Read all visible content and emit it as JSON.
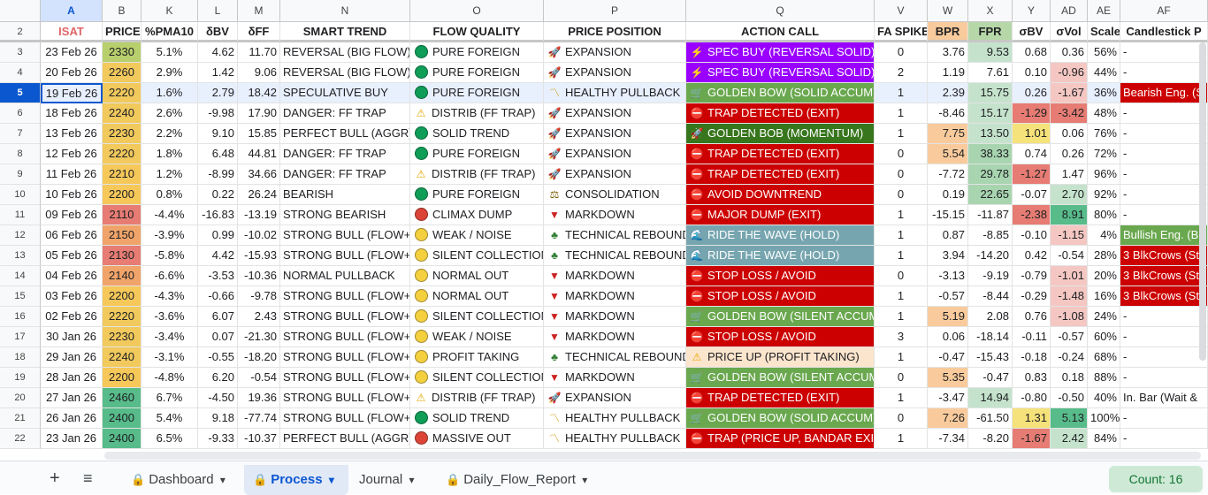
{
  "columns": [
    {
      "letter": "A",
      "title": "ISAT"
    },
    {
      "letter": "B",
      "title": "PRICE"
    },
    {
      "letter": "K",
      "title": "%PMA10"
    },
    {
      "letter": "L",
      "title": "δBV"
    },
    {
      "letter": "M",
      "title": "δFF"
    },
    {
      "letter": "N",
      "title": "SMART TREND"
    },
    {
      "letter": "O",
      "title": "FLOW QUALITY"
    },
    {
      "letter": "P",
      "title": "PRICE POSITION"
    },
    {
      "letter": "Q",
      "title": "ACTION CALL"
    },
    {
      "letter": "V",
      "title": "FA SPIKE"
    },
    {
      "letter": "W",
      "title": "BPR"
    },
    {
      "letter": "X",
      "title": "FPR"
    },
    {
      "letter": "Y",
      "title": "σBV"
    },
    {
      "letter": "AD",
      "title": "σVol"
    },
    {
      "letter": "AE",
      "title": "Scale"
    },
    {
      "letter": "AF",
      "title": "Candlestick P"
    }
  ],
  "header_row_number": "2",
  "rows": [
    {
      "n": "3",
      "date": "23 Feb 26",
      "price": "2330",
      "pma": "5.1%",
      "dbv": "4.62",
      "dff": "11.70",
      "trend": "REVERSAL (BIG FLOW)",
      "flow": "PURE FOREIGN",
      "pos": "EXPANSION",
      "action": "SPEC BUY (REVERSAL SOLID)",
      "fa": "0",
      "bpr": "3.76",
      "fpr": "9.53",
      "sbv": "0.68",
      "svol": "0.36",
      "scale": "56%",
      "candle": "-"
    },
    {
      "n": "4",
      "date": "20 Feb 26",
      "price": "2260",
      "pma": "2.9%",
      "dbv": "1.42",
      "dff": "9.06",
      "trend": "REVERSAL (BIG FLOW)",
      "flow": "PURE FOREIGN",
      "pos": "EXPANSION",
      "action": "SPEC BUY (REVERSAL SOLID)",
      "fa": "2",
      "bpr": "1.19",
      "fpr": "7.61",
      "sbv": "0.10",
      "svol": "-0.96",
      "scale": "44%",
      "candle": "-"
    },
    {
      "n": "5",
      "date": "19 Feb 26",
      "price": "2220",
      "pma": "1.6%",
      "dbv": "2.79",
      "dff": "18.42",
      "trend": "SPECULATIVE BUY",
      "flow": "PURE FOREIGN",
      "pos": "HEALTHY PULLBACK",
      "action": "GOLDEN BOW (SOLID ACCUM)",
      "fa": "1",
      "bpr": "2.39",
      "fpr": "15.75",
      "sbv": "0.26",
      "svol": "-1.67",
      "scale": "36%",
      "candle": "Bearish Eng. (S"
    },
    {
      "n": "6",
      "date": "18 Feb 26",
      "price": "2240",
      "pma": "2.6%",
      "dbv": "-9.98",
      "dff": "17.90",
      "trend": "DANGER: FF TRAP",
      "flow": "DISTRIB (FF TRAP)",
      "pos": "EXPANSION",
      "action": "TRAP DETECTED (EXIT)",
      "fa": "1",
      "bpr": "-8.46",
      "fpr": "15.17",
      "sbv": "-1.29",
      "svol": "-3.42",
      "scale": "48%",
      "candle": "-"
    },
    {
      "n": "7",
      "date": "13 Feb 26",
      "price": "2230",
      "pma": "2.2%",
      "dbv": "9.10",
      "dff": "15.85",
      "trend": "PERFECT BULL (AGGR)",
      "flow": "SOLID TREND",
      "pos": "EXPANSION",
      "action": "GOLDEN BOB (MOMENTUM)",
      "fa": "1",
      "bpr": "7.75",
      "fpr": "13.50",
      "sbv": "1.01",
      "svol": "0.06",
      "scale": "76%",
      "candle": "-"
    },
    {
      "n": "8",
      "date": "12 Feb 26",
      "price": "2220",
      "pma": "1.8%",
      "dbv": "6.48",
      "dff": "44.81",
      "trend": "DANGER: FF TRAP",
      "flow": "PURE FOREIGN",
      "pos": "EXPANSION",
      "action": "TRAP DETECTED (EXIT)",
      "fa": "0",
      "bpr": "5.54",
      "fpr": "38.33",
      "sbv": "0.74",
      "svol": "0.26",
      "scale": "72%",
      "candle": "-"
    },
    {
      "n": "9",
      "date": "11 Feb 26",
      "price": "2210",
      "pma": "1.2%",
      "dbv": "-8.99",
      "dff": "34.66",
      "trend": "DANGER: FF TRAP",
      "flow": "DISTRIB (FF TRAP)",
      "pos": "EXPANSION",
      "action": "TRAP DETECTED (EXIT)",
      "fa": "0",
      "bpr": "-7.72",
      "fpr": "29.78",
      "sbv": "-1.27",
      "svol": "1.47",
      "scale": "96%",
      "candle": "-"
    },
    {
      "n": "10",
      "date": "10 Feb 26",
      "price": "2200",
      "pma": "0.8%",
      "dbv": "0.22",
      "dff": "26.24",
      "trend": "BEARISH",
      "flow": "PURE FOREIGN",
      "pos": "CONSOLIDATION",
      "action": "AVOID DOWNTREND",
      "fa": "0",
      "bpr": "0.19",
      "fpr": "22.65",
      "sbv": "-0.07",
      "svol": "2.70",
      "scale": "92%",
      "candle": "-"
    },
    {
      "n": "11",
      "date": "09 Feb 26",
      "price": "2110",
      "pma": "-4.4%",
      "dbv": "-16.83",
      "dff": "-13.19",
      "trend": "STRONG BEARISH",
      "flow": "CLIMAX DUMP",
      "pos": "MARKDOWN",
      "action": "MAJOR DUMP (EXIT)",
      "fa": "1",
      "bpr": "-15.15",
      "fpr": "-11.87",
      "sbv": "-2.38",
      "svol": "8.91",
      "scale": "80%",
      "candle": "-"
    },
    {
      "n": "12",
      "date": "06 Feb 26",
      "price": "2150",
      "pma": "-3.9%",
      "dbv": "0.99",
      "dff": "-10.02",
      "trend": "STRONG BULL (FLOW+)",
      "flow": "WEAK / NOISE",
      "pos": "TECHNICAL REBOUND",
      "action": "RIDE THE WAVE (HOLD)",
      "fa": "1",
      "bpr": "0.87",
      "fpr": "-8.85",
      "sbv": "-0.10",
      "svol": "-1.15",
      "scale": "4%",
      "candle": "Bullish Eng. (B"
    },
    {
      "n": "13",
      "date": "05 Feb 26",
      "price": "2130",
      "pma": "-5.8%",
      "dbv": "4.42",
      "dff": "-15.93",
      "trend": "STRONG BULL (FLOW+)",
      "flow": "SILENT COLLECTION",
      "pos": "TECHNICAL REBOUND",
      "action": "RIDE THE WAVE (HOLD)",
      "fa": "1",
      "bpr": "3.94",
      "fpr": "-14.20",
      "sbv": "0.42",
      "svol": "-0.54",
      "scale": "28%",
      "candle": "3 BlkCrows (St"
    },
    {
      "n": "14",
      "date": "04 Feb 26",
      "price": "2140",
      "pma": "-6.6%",
      "dbv": "-3.53",
      "dff": "-10.36",
      "trend": "NORMAL PULLBACK",
      "flow": "NORMAL OUT",
      "pos": "MARKDOWN",
      "action": "STOP LOSS / AVOID",
      "fa": "0",
      "bpr": "-3.13",
      "fpr": "-9.19",
      "sbv": "-0.79",
      "svol": "-1.01",
      "scale": "20%",
      "candle": "3 BlkCrows (St"
    },
    {
      "n": "15",
      "date": "03 Feb 26",
      "price": "2200",
      "pma": "-4.3%",
      "dbv": "-0.66",
      "dff": "-9.78",
      "trend": "STRONG BULL (FLOW+)",
      "flow": "NORMAL OUT",
      "pos": "MARKDOWN",
      "action": "STOP LOSS / AVOID",
      "fa": "1",
      "bpr": "-0.57",
      "fpr": "-8.44",
      "sbv": "-0.29",
      "svol": "-1.48",
      "scale": "16%",
      "candle": "3 BlkCrows (St"
    },
    {
      "n": "16",
      "date": "02 Feb 26",
      "price": "2220",
      "pma": "-3.6%",
      "dbv": "6.07",
      "dff": "2.43",
      "trend": "STRONG BULL (FLOW+)",
      "flow": "SILENT COLLECTION",
      "pos": "MARKDOWN",
      "action": "GOLDEN BOW (SILENT ACCUM)",
      "fa": "1",
      "bpr": "5.19",
      "fpr": "2.08",
      "sbv": "0.76",
      "svol": "-1.08",
      "scale": "24%",
      "candle": "-"
    },
    {
      "n": "17",
      "date": "30 Jan 26",
      "price": "2230",
      "pma": "-3.4%",
      "dbv": "0.07",
      "dff": "-21.30",
      "trend": "STRONG BULL (FLOW+)",
      "flow": "WEAK / NOISE",
      "pos": "MARKDOWN",
      "action": "STOP LOSS / AVOID",
      "fa": "3",
      "bpr": "0.06",
      "fpr": "-18.14",
      "sbv": "-0.11",
      "svol": "-0.57",
      "scale": "60%",
      "candle": "-"
    },
    {
      "n": "18",
      "date": "29 Jan 26",
      "price": "2240",
      "pma": "-3.1%",
      "dbv": "-0.55",
      "dff": "-18.20",
      "trend": "STRONG BULL (FLOW+)",
      "flow": "PROFIT TAKING",
      "pos": "TECHNICAL REBOUND",
      "action": "PRICE UP (PROFIT TAKING)",
      "fa": "1",
      "bpr": "-0.47",
      "fpr": "-15.43",
      "sbv": "-0.18",
      "svol": "-0.24",
      "scale": "68%",
      "candle": "-"
    },
    {
      "n": "19",
      "date": "28 Jan 26",
      "price": "2200",
      "pma": "-4.8%",
      "dbv": "6.20",
      "dff": "-0.54",
      "trend": "STRONG BULL (FLOW+)",
      "flow": "SILENT COLLECTION",
      "pos": "MARKDOWN",
      "action": "GOLDEN BOW (SILENT ACCUM)",
      "fa": "0",
      "bpr": "5.35",
      "fpr": "-0.47",
      "sbv": "0.83",
      "svol": "0.18",
      "scale": "88%",
      "candle": "-"
    },
    {
      "n": "20",
      "date": "27 Jan 26",
      "price": "2460",
      "pma": "6.7%",
      "dbv": "-4.50",
      "dff": "19.36",
      "trend": "STRONG BULL (FLOW+)",
      "flow": "DISTRIB (FF TRAP)",
      "pos": "EXPANSION",
      "action": "TRAP DETECTED (EXIT)",
      "fa": "1",
      "bpr": "-3.47",
      "fpr": "14.94",
      "sbv": "-0.80",
      "svol": "-0.50",
      "scale": "40%",
      "candle": "In. Bar (Wait &"
    },
    {
      "n": "21",
      "date": "26 Jan 26",
      "price": "2400",
      "pma": "5.4%",
      "dbv": "9.18",
      "dff": "-77.74",
      "trend": "STRONG BULL (FLOW+)",
      "flow": "SOLID TREND",
      "pos": "HEALTHY PULLBACK",
      "action": "GOLDEN BOW (SOLID ACCUM)",
      "fa": "0",
      "bpr": "7.26",
      "fpr": "-61.50",
      "sbv": "1.31",
      "svol": "5.13",
      "scale": "100%",
      "candle": "-"
    },
    {
      "n": "22",
      "date": "23 Jan 26",
      "price": "2400",
      "pma": "6.5%",
      "dbv": "-9.33",
      "dff": "-10.37",
      "trend": "PERFECT BULL (AGGR)",
      "flow": "MASSIVE OUT",
      "pos": "HEALTHY PULLBACK",
      "action": "TRAP (PRICE UP, BANDAR EXIT)",
      "fa": "1",
      "bpr": "-7.34",
      "fpr": "-8.20",
      "sbv": "-1.67",
      "svol": "2.42",
      "scale": "84%",
      "candle": "-"
    }
  ],
  "tabs": [
    {
      "label": "Dashboard",
      "locked": true,
      "active": false
    },
    {
      "label": "Process",
      "locked": true,
      "active": true
    },
    {
      "label": "Journal",
      "locked": false,
      "active": false
    },
    {
      "label": "Daily_Flow_Report",
      "locked": true,
      "active": false
    }
  ],
  "status": {
    "count_label": "Count: 16"
  },
  "icons": {
    "add": "plus-icon",
    "menu": "hamburger-icon",
    "lock": "lock-icon",
    "dropdown": "caret-down-icon"
  },
  "colors": {
    "accent": "#0b57d0",
    "header_selected": "#d3e3fd",
    "trap_red": "#cc0000",
    "spec_purple": "#9900ff",
    "golden_green": "#6aa84f",
    "ride_blue": "#76a5af",
    "profit_orange": "#fce5cd"
  }
}
